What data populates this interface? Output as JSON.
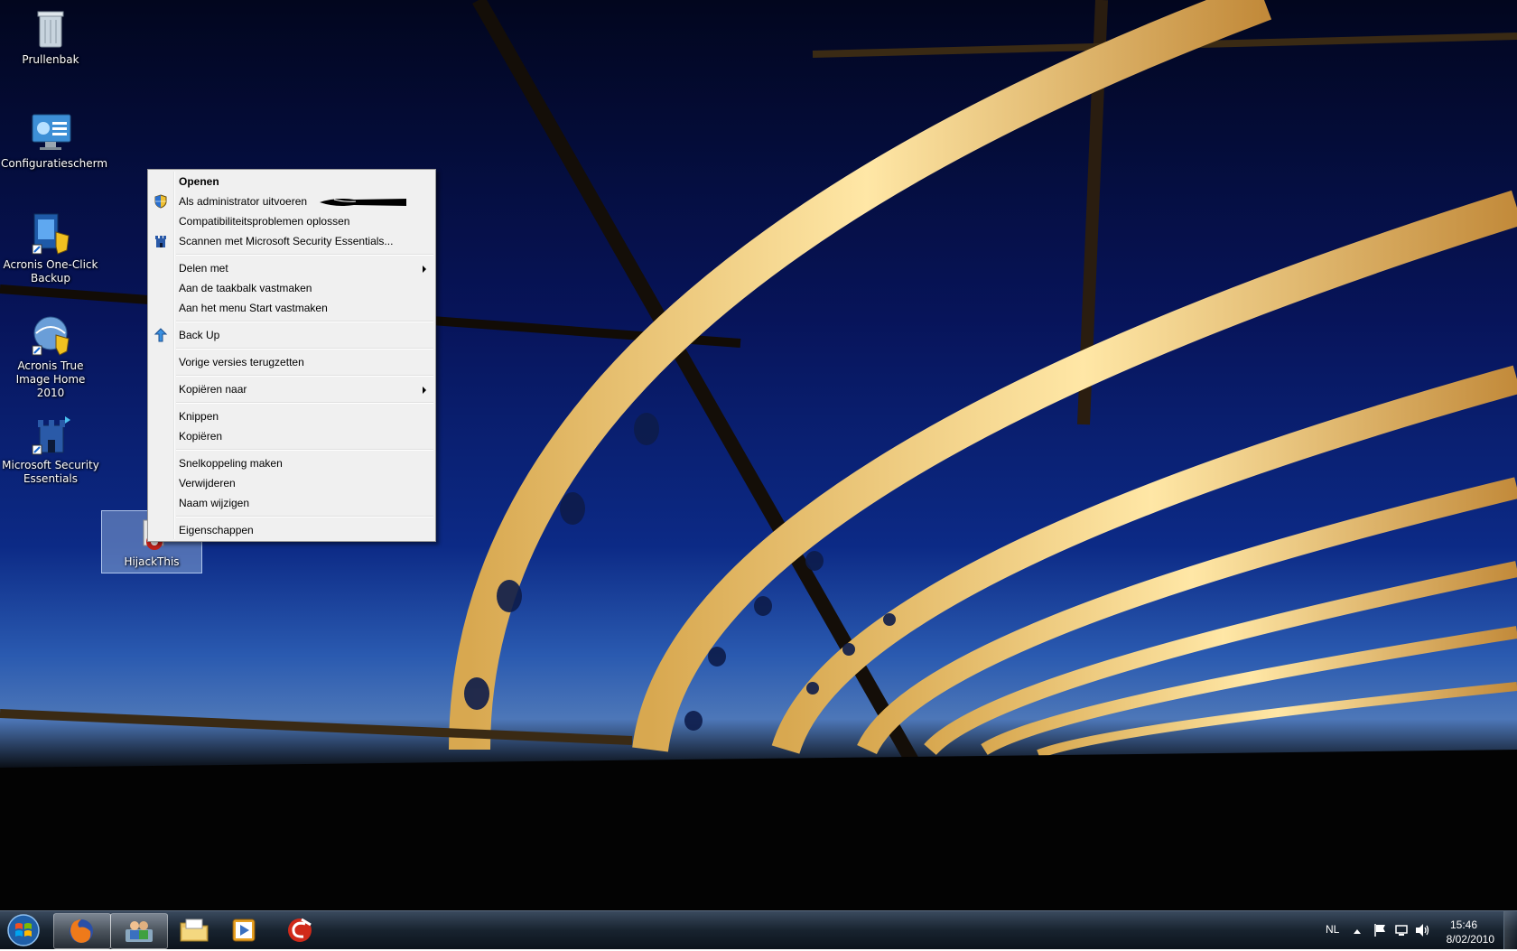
{
  "desktop_icons": [
    {
      "label": "Prullenbak",
      "icon": "recycle-bin-icon"
    },
    {
      "label": "Configuratiescherm",
      "icon": "control-panel-icon"
    },
    {
      "label": "Acronis One-Click Backup",
      "icon": "acronis-backup-icon"
    },
    {
      "label": "Acronis True Image Home 2010",
      "icon": "acronis-true-image-icon"
    },
    {
      "label": "Microsoft Security Essentials",
      "icon": "security-essentials-icon"
    },
    {
      "label": "HijackThis",
      "icon": "hijackthis-icon",
      "selected": true
    }
  ],
  "context_menu": {
    "open": "Openen",
    "run_as_admin": "Als administrator uitvoeren",
    "troubleshoot": "Compatibiliteitsproblemen oplossen",
    "scan_mse": "Scannen met Microsoft Security Essentials...",
    "share_with": "Delen met",
    "pin_taskbar": "Aan de taakbalk vastmaken",
    "pin_start": "Aan het menu Start vastmaken",
    "backup": "Back Up",
    "restore_versions": "Vorige versies terugzetten",
    "send_to": "Kopiëren naar",
    "cut": "Knippen",
    "copy": "Kopiëren",
    "create_shortcut": "Snelkoppeling maken",
    "delete": "Verwijderen",
    "rename": "Naam wijzigen",
    "properties": "Eigenschappen"
  },
  "taskbar": {
    "pinned": [
      "start-orb-icon",
      "firefox-icon",
      "users-icon",
      "explorer-folder-icon",
      "media-player-icon",
      "ccleaner-icon"
    ],
    "tray": {
      "language": "NL",
      "time": "15:46",
      "date": "8/02/2010"
    }
  },
  "colors": {
    "menu_bg": "#f0f0f0",
    "taskbar": "#18232f",
    "selection": "#a0bee6"
  }
}
